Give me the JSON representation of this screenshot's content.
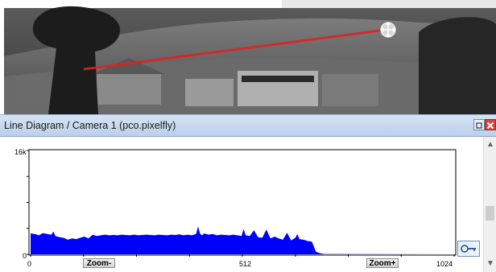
{
  "window": {
    "title": "Line Diagram / Camera 1 (pco.pixelfly)"
  },
  "camera_image": {
    "overlay_line_color": "#e02020",
    "handle_icon": "move-crosshair-icon"
  },
  "diagram": {
    "y_top_label": "16k",
    "y_bottom_label": "0",
    "x_labels": [
      "0",
      "512",
      "1024"
    ],
    "zoom_minus_label": "Zoom-",
    "zoom_plus_label": "Zoom+",
    "cursor_tool_icon": "key-cursor-icon",
    "fill_color": "#0000ff"
  },
  "chart_data": {
    "type": "area",
    "xlim": [
      0,
      1024
    ],
    "ylim": [
      0,
      16384
    ],
    "x": [
      0,
      10,
      20,
      30,
      40,
      50,
      55,
      60,
      70,
      80,
      90,
      100,
      110,
      120,
      130,
      140,
      150,
      160,
      170,
      180,
      190,
      200,
      210,
      220,
      230,
      240,
      250,
      260,
      270,
      280,
      290,
      300,
      310,
      320,
      330,
      340,
      350,
      360,
      370,
      380,
      390,
      400,
      405,
      410,
      415,
      420,
      430,
      440,
      450,
      460,
      470,
      480,
      490,
      500,
      510,
      515,
      520,
      530,
      540,
      550,
      560,
      570,
      580,
      590,
      600,
      610,
      620,
      630,
      640,
      645,
      650,
      660,
      670,
      680,
      690,
      700,
      710,
      1024
    ],
    "values": [
      3300,
      3200,
      3000,
      3350,
      3200,
      3100,
      3600,
      2900,
      2700,
      2600,
      2300,
      2500,
      2400,
      2600,
      2800,
      2500,
      3100,
      2900,
      3000,
      3100,
      3000,
      3050,
      3000,
      3100,
      3050,
      3000,
      3100,
      3000,
      3050,
      3100,
      3050,
      3000,
      3100,
      3050,
      3000,
      3100,
      3050,
      3150,
      3000,
      3100,
      3000,
      3200,
      4400,
      3200,
      3000,
      3300,
      3100,
      3200,
      3000,
      3100,
      3050,
      3000,
      3100,
      3000,
      2900,
      4000,
      3000,
      2900,
      3800,
      2700,
      2600,
      3900,
      2500,
      2800,
      2500,
      2300,
      3400,
      2200,
      2600,
      3200,
      2400,
      2300,
      2100,
      2000,
      400,
      150,
      50,
      0
    ]
  }
}
